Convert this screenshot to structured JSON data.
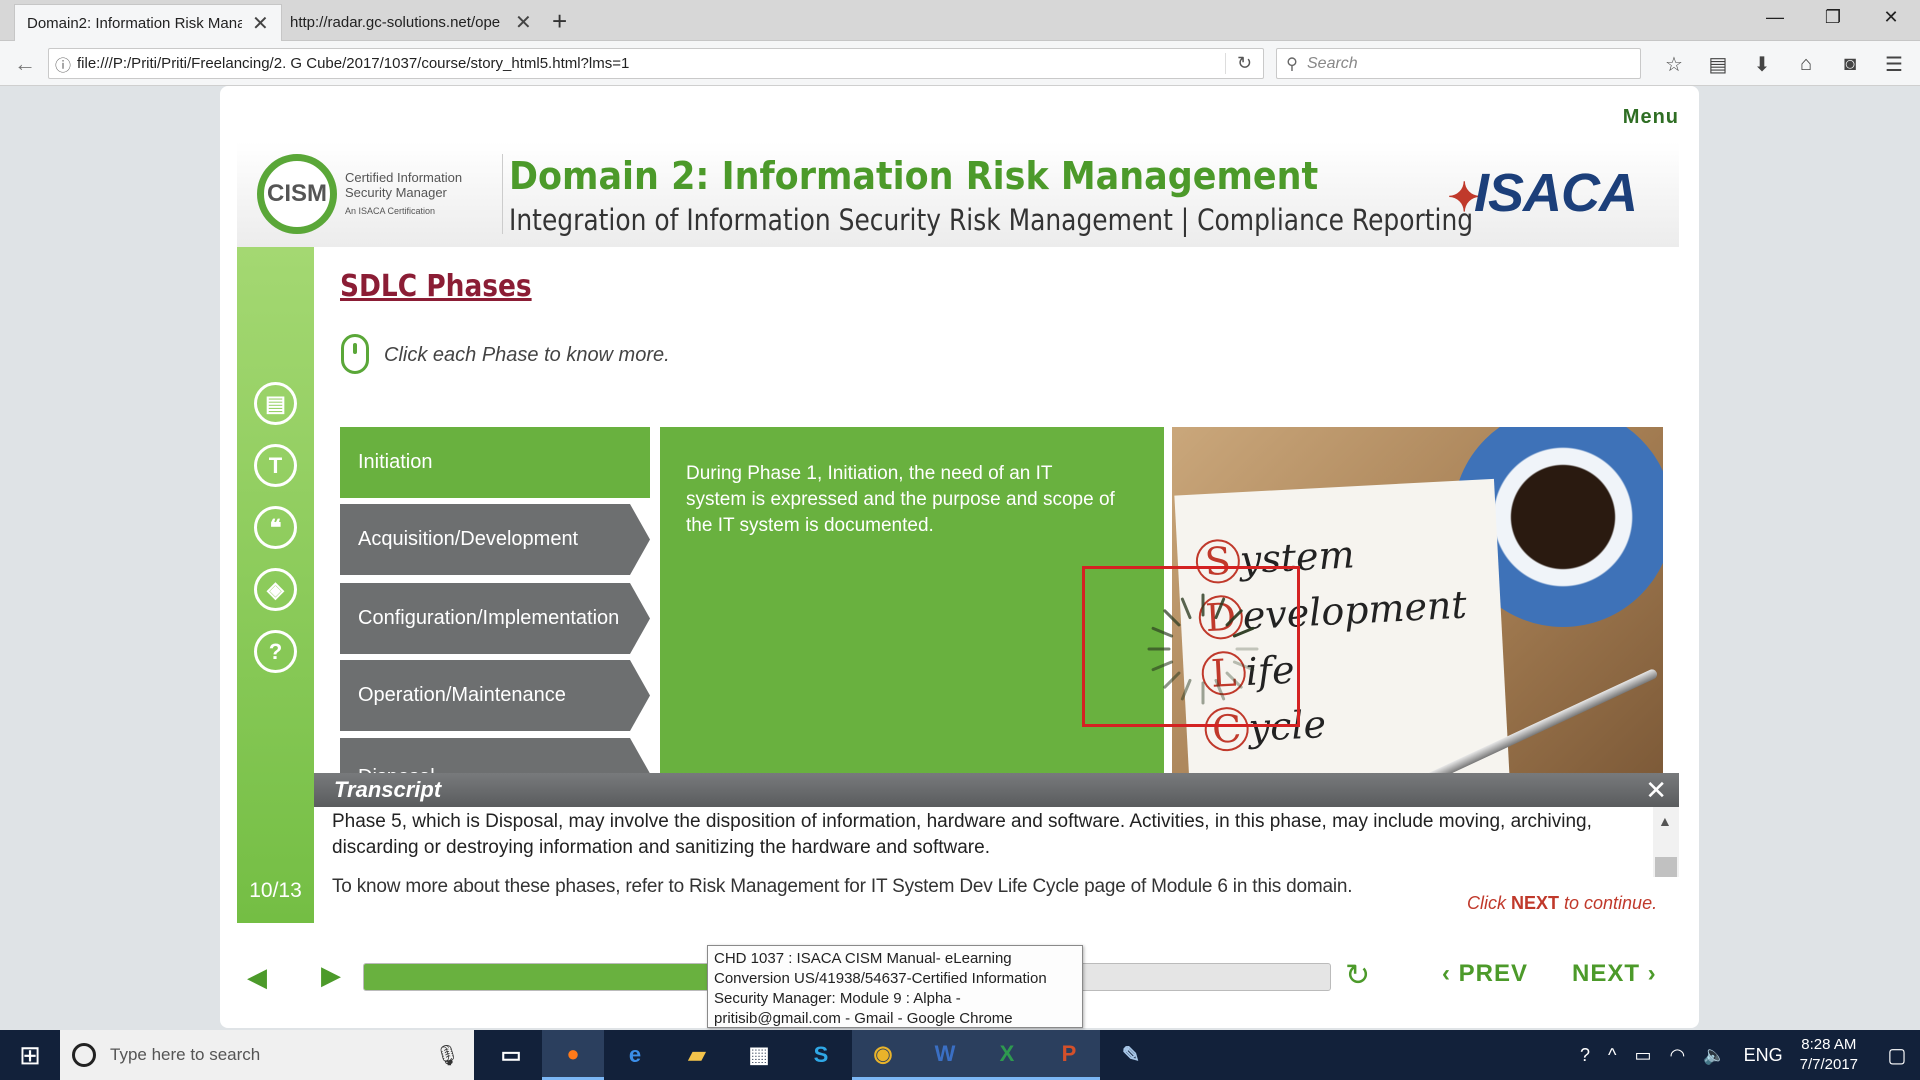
{
  "browser": {
    "tabs": [
      {
        "label": "Domain2: Information Risk Mana",
        "active": true
      },
      {
        "label": "http://radar.gc-solutions.net/ope",
        "active": false
      }
    ],
    "url": "file:///P:/Priti/Priti/Freelancing/2. G Cube/2017/1037/course/story_html5.html?lms=1",
    "search_placeholder": "Search",
    "toolbar_icons": [
      "bookmark-star-icon",
      "reading-list-icon",
      "download-icon",
      "home-icon",
      "pocket-icon",
      "hamburger-menu-icon"
    ]
  },
  "course": {
    "menu_label": "Menu",
    "logo": {
      "name": "CISM",
      "tagline": "Certified Information Security Manager",
      "sub": "An ISACA Certification"
    },
    "banner_title": "Domain 2: Information Risk Management",
    "banner_subtitle": "Integration of Information Security Risk Management | Compliance Reporting",
    "isaca_logo": "ISACA",
    "slide_title": "SDLC Phases",
    "instruction": "Click each Phase to know more.",
    "rail_icons": [
      "notes-icon",
      "text-icon",
      "quote-icon",
      "resources-icon",
      "help-icon"
    ],
    "page_counter": "10/13",
    "phases": [
      {
        "label": "Initiation",
        "active": true
      },
      {
        "label": "Acquisition/Development",
        "active": false
      },
      {
        "label": "Configuration/Implementation",
        "active": false
      },
      {
        "label": "Operation/Maintenance",
        "active": false
      },
      {
        "label": "Disposal",
        "active": false
      }
    ],
    "phase_content": "During Phase 1, Initiation, the need of an IT system is expressed and the purpose and scope of the IT system is documented.",
    "sdlc_image": {
      "words": [
        {
          "cap": "S",
          "rest": "ystem"
        },
        {
          "cap": "D",
          "rest": "evelopment"
        },
        {
          "cap": "L",
          "rest": "ife"
        },
        {
          "cap": "C",
          "rest": "ycle"
        }
      ]
    },
    "transcript": {
      "title": "Transcript",
      "body": "Phase 5, which is Disposal, may involve the disposition of information, hardware and software. Activities, in this phase, may include moving, archiving, discarding or destroying information and sanitizing the hardware and software.",
      "footer": "To know more about these phases, refer to Risk Management for IT System Dev Life Cycle page of Module 6 in this domain."
    },
    "next_hint": {
      "pre": "Click ",
      "bold": "NEXT",
      "post": " to continue."
    },
    "controls": {
      "prev_label": "PREV",
      "next_label": "NEXT",
      "progress": 0.62
    }
  },
  "tooltip": {
    "text": "CHD 1037 : ISACA CISM Manual- eLearning Conversion US/41938/54637-Certified Information Security Manager: Module 9 : Alpha - pritisib@gmail.com - Gmail - Google Chrome"
  },
  "taskbar": {
    "search_placeholder": "Type here to search",
    "apps": [
      "Firefox",
      "Edge",
      "File Explorer",
      "Store",
      "Skype",
      "Chrome",
      "Word",
      "Excel",
      "PowerPoint",
      "Paint"
    ],
    "language": "ENG",
    "time": "8:28 AM",
    "date": "7/7/2017"
  },
  "colors": {
    "accent_green": "#69b13f",
    "title_maroon": "#8b1d35",
    "alert_red": "#d42222",
    "taskbar": "#12213a"
  }
}
